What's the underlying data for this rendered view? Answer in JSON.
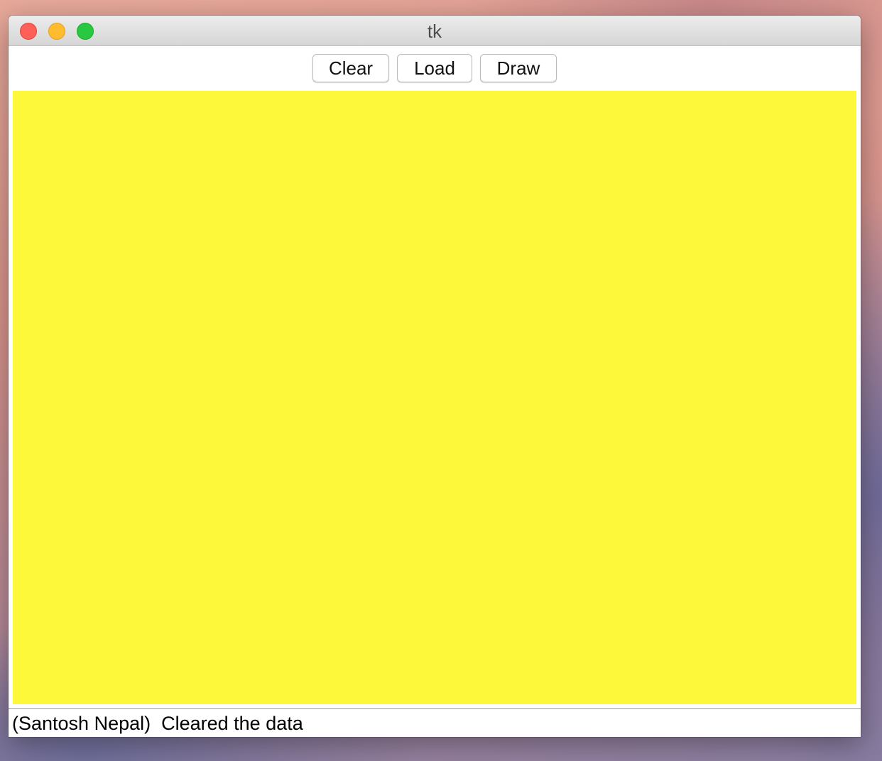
{
  "window": {
    "title": "tk"
  },
  "toolbar": {
    "clear_label": "Clear",
    "load_label": "Load",
    "draw_label": "Draw"
  },
  "canvas": {
    "background_color": "#fdf93a"
  },
  "status_bar": {
    "text": "(Santosh Nepal)  Cleared the data"
  }
}
